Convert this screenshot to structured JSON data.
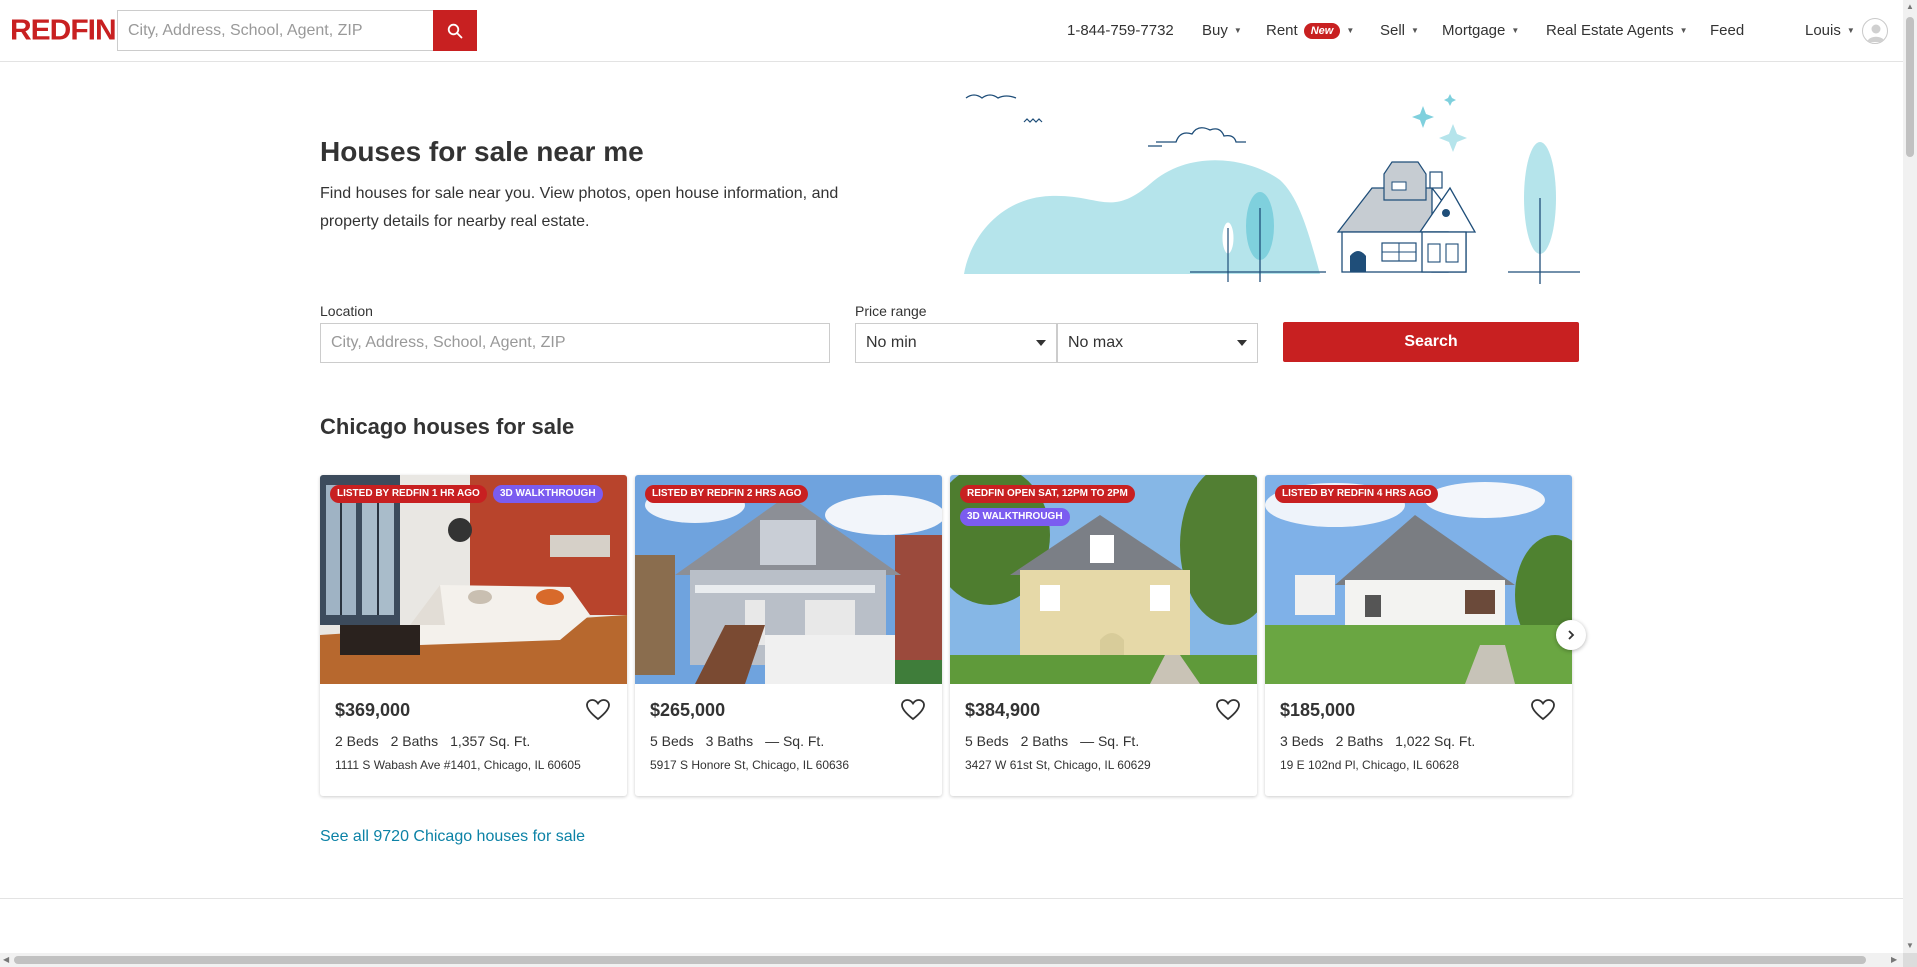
{
  "header": {
    "logo": "REDFIN",
    "search_placeholder": "City, Address, School, Agent, ZIP",
    "phone": "1-844-759-7732",
    "nav": {
      "buy": "Buy",
      "rent": "Rent",
      "rent_badge": "New",
      "sell": "Sell",
      "mortgage": "Mortgage",
      "agents": "Real Estate Agents",
      "feed": "Feed",
      "user": "Louis"
    }
  },
  "hero": {
    "title": "Houses for sale near me",
    "description": "Find houses for sale near you. View photos, open house information, and property details for nearby real estate."
  },
  "search_form": {
    "location_label": "Location",
    "location_placeholder": "City, Address, School, Agent, ZIP",
    "price_label": "Price range",
    "min_value": "No min",
    "max_value": "No max",
    "search_button": "Search"
  },
  "section": {
    "title": "Chicago houses for sale",
    "see_all": "See all 9720 Chicago houses for sale"
  },
  "listings": [
    {
      "tags": [
        "LISTED BY REDFIN 1 HR AGO",
        "3D WALKTHROUGH"
      ],
      "price": "$369,000",
      "beds": "2 Beds",
      "baths": "2 Baths",
      "sqft": "1,357 Sq. Ft.",
      "address": "1111 S Wabash Ave #1401, Chicago, IL 60605"
    },
    {
      "tags": [
        "LISTED BY REDFIN 2 HRS AGO"
      ],
      "price": "$265,000",
      "beds": "5 Beds",
      "baths": "3 Baths",
      "sqft": "— Sq. Ft.",
      "address": "5917 S Honore St, Chicago, IL 60636"
    },
    {
      "tags": [
        "REDFIN OPEN SAT, 12PM TO 2PM",
        "3D WALKTHROUGH"
      ],
      "price": "$384,900",
      "beds": "5 Beds",
      "baths": "2 Baths",
      "sqft": "— Sq. Ft.",
      "address": "3427 W 61st St, Chicago, IL 60629"
    },
    {
      "tags": [
        "LISTED BY REDFIN 4 HRS AGO"
      ],
      "price": "$185,000",
      "beds": "3 Beds",
      "baths": "2 Baths",
      "sqft": "1,022 Sq. Ft.",
      "address": "19 E 102nd Pl, Chicago, IL 60628"
    }
  ],
  "colors": {
    "brand_red": "#c82021",
    "link_blue": "#0c82a6",
    "tag_purple": "#7b5cf0",
    "illustration_teal": "#b5e4eb"
  }
}
